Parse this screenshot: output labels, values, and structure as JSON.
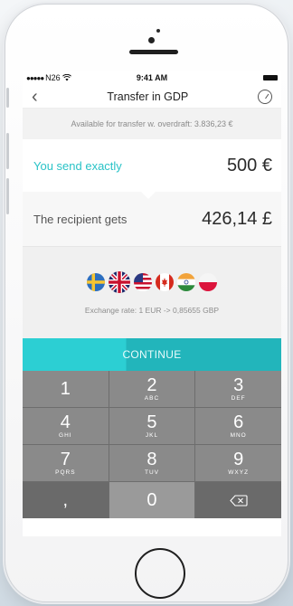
{
  "status_bar": {
    "carrier": "N26",
    "time": "9:41 AM"
  },
  "nav": {
    "title": "Transfer in GDP"
  },
  "available": "Available for transfer w. overdraft: 3.836,23 €",
  "send": {
    "label": "You send exactly",
    "amount": "500 €"
  },
  "receive": {
    "label": "The recipient gets",
    "amount": "426,14 £"
  },
  "flags": [
    "sweden-flag",
    "uk-flag",
    "usa-flag",
    "canada-flag",
    "india-flag",
    "poland-flag"
  ],
  "selected_flag": "uk-flag",
  "exchange_rate": "Exchange rate: 1 EUR -> 0,85655 GBP",
  "continue_label": "CONTINUE",
  "keypad": {
    "keys": [
      {
        "num": "1",
        "letters": ""
      },
      {
        "num": "2",
        "letters": "ABC"
      },
      {
        "num": "3",
        "letters": "DEF"
      },
      {
        "num": "4",
        "letters": "GHI"
      },
      {
        "num": "5",
        "letters": "JKL"
      },
      {
        "num": "6",
        "letters": "MNO"
      },
      {
        "num": "7",
        "letters": "PQRS"
      },
      {
        "num": "8",
        "letters": "TUV"
      },
      {
        "num": "9",
        "letters": "WXYZ"
      },
      {
        "num": ",",
        "letters": ""
      },
      {
        "num": "0",
        "letters": ""
      }
    ]
  },
  "colors": {
    "accent": "#2ac3c7",
    "continue_bg": "#2ccfd3",
    "keypad_key": "#8a8a8a"
  }
}
